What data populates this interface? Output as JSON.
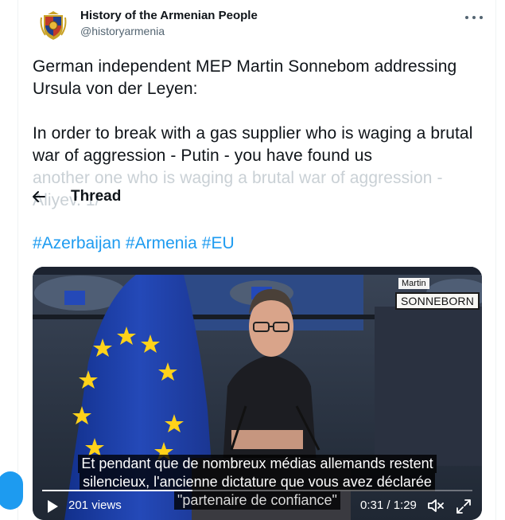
{
  "tweet": {
    "author_name": "History of the Armenian People",
    "author_handle": "@historyarmenia",
    "text_lines": [
      "German independent MEP Martin Sonnebom addressing Ursula von der Leyen:",
      "In order to break with a gas supplier who is waging a brutal war of aggression - Putin - you have found us",
      "another one who is waging a brutal war of aggression - Aliyev. 1/"
    ],
    "hashtags": [
      "#Azerbaijan",
      "#Armenia",
      "#EU"
    ]
  },
  "thread_header": {
    "back_icon": "arrow-left-icon",
    "title": "Thread"
  },
  "video": {
    "nameplate_first": "Martin",
    "nameplate_last": "SONNEBORN",
    "subtitles": [
      "Et pendant que de nombreux médias allemands restent",
      "silencieux, l'ancienne dictature que vous avez déclarée",
      "\"partenaire de confiance\""
    ],
    "views": "201 views",
    "time": "0:31 / 1:29",
    "progress_fraction": 0.35
  },
  "colors": {
    "link": "#1d9bf0",
    "text": "#0f1419",
    "secondary": "#536471",
    "eu_flag": "#1a3fa6",
    "eu_star": "#ffd21a"
  },
  "icons": [
    "more-icon",
    "arrow-left-icon",
    "play-icon",
    "volume-icon",
    "fullscreen-icon",
    "avatar-crest-icon"
  ]
}
